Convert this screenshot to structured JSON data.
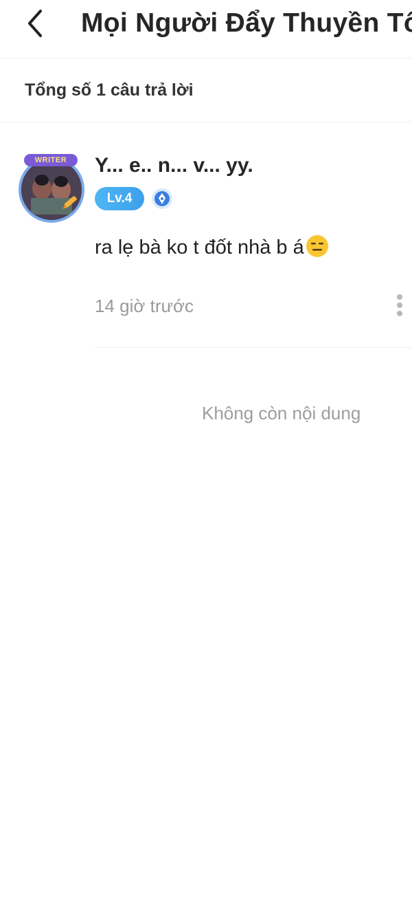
{
  "header": {
    "title": "Mọi Người Đẩy Thuyền Tô"
  },
  "summary": {
    "text": "Tổng số 1 câu trả lời"
  },
  "comments": [
    {
      "username": "Y... e.. n... v... yy.",
      "avatar_badge": "WRITER",
      "level": "Lv.4",
      "text": "ra lẹ bà ko t đốt nhà b á",
      "emoji": "expressionless-face",
      "time": "14 giờ trước"
    }
  ],
  "footer": {
    "end_text": "Không còn nội dung"
  },
  "colors": {
    "level_badge": "#3da0ea",
    "muted_text": "#9a9a9a",
    "divider": "#f0f0f0"
  },
  "icons": {
    "back": "chevron-left-icon",
    "more": "more-vertical-icon",
    "writer_badge": "pen-nib-icon"
  }
}
